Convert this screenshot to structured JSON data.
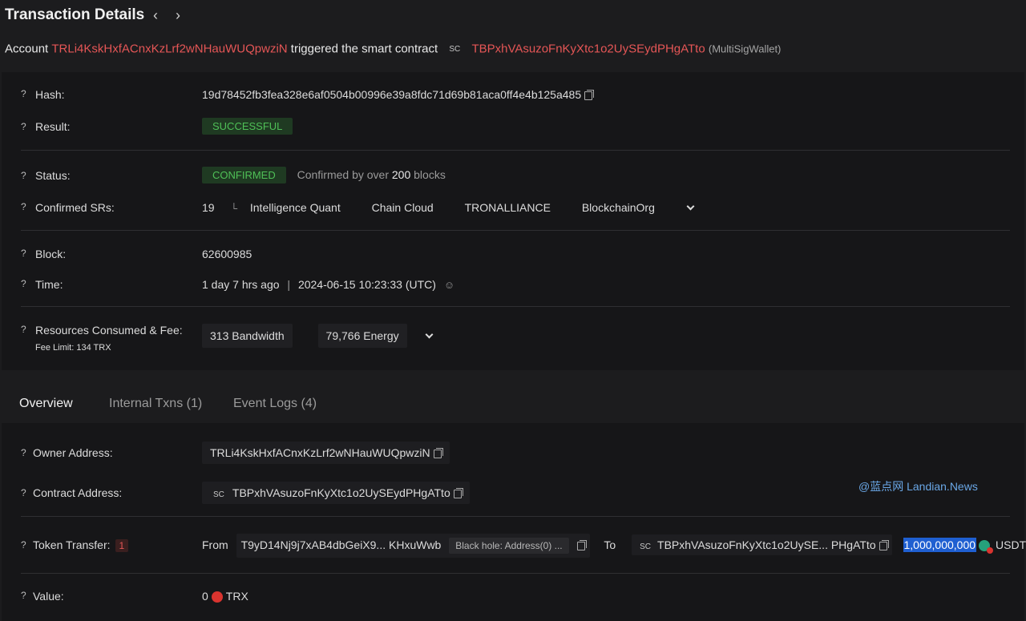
{
  "header": {
    "title": "Transaction Details"
  },
  "summary": {
    "prefix": "Account",
    "account": "TRLi4KskHxfACnxKzLrf2wNHauWUQpwziN",
    "middle": "triggered the smart contract",
    "sc": "SC",
    "contract": "TBPxhVAsuzoFnKyXtc1o2UySEydPHgATto",
    "contract_tag": "(MultiSigWallet)"
  },
  "details": {
    "hash_label": "Hash:",
    "hash": "19d78452fb3fea328e6af0504b00996e39a8fdc71d69b81aca0ff4e4b125a485",
    "result_label": "Result:",
    "result": "SUCCESSFUL",
    "status_label": "Status:",
    "status": "CONFIRMED",
    "confirm_prefix": "Confirmed by over",
    "confirm_count": "200",
    "confirm_suffix": "blocks",
    "srs_label": "Confirmed SRs:",
    "srs_count": "19",
    "srs": [
      "Intelligence Quant",
      "Chain Cloud",
      "TRONALLIANCE",
      "BlockchainOrg"
    ],
    "block_label": "Block:",
    "block": "62600985",
    "time_label": "Time:",
    "time_ago": "1 day 7 hrs ago",
    "time_sep": "|",
    "time": "2024-06-15 10:23:33 (UTC)",
    "resources_label": "Resources Consumed & Fee:",
    "fee_limit": "Fee Limit: 134 TRX",
    "bandwidth_value": "313",
    "bandwidth_label": "Bandwidth",
    "energy_value": "79,766",
    "energy_label": "Energy"
  },
  "tabs": [
    {
      "label": "Overview"
    },
    {
      "label": "Internal Txns (1)"
    },
    {
      "label": "Event Logs (4)"
    }
  ],
  "overview": {
    "owner_label": "Owner Address:",
    "owner": "TRLi4KskHxfACnxKzLrf2wNHauWUQpwziN",
    "contract_label": "Contract Address:",
    "contract_sc": "SC",
    "contract": "TBPxhVAsuzoFnKyXtc1o2UySEydPHgATto",
    "transfer_label": "Token Transfer:",
    "transfer_count": "1",
    "from_label": "From",
    "from_addr": "T9yD14Nj9j7xAB4dbGeiX9... KHxuWwb",
    "from_badge": "Black hole: Address(0) ...",
    "to_label": "To",
    "to_sc": "SC",
    "to_addr": "TBPxhVAsuzoFnKyXtc1o2UySE... PHgATto",
    "amount": "1,000,000,000",
    "token": "USDT",
    "value_label": "Value:",
    "value": "0",
    "value_unit": "TRX"
  },
  "watermark": "@蓝点网 Landian.News",
  "colors": {
    "accent_red": "#e55656",
    "success_green": "#4fc057",
    "highlight_blue": "#1f5fd1",
    "background": "#1c1c1e",
    "panel": "#161618"
  }
}
